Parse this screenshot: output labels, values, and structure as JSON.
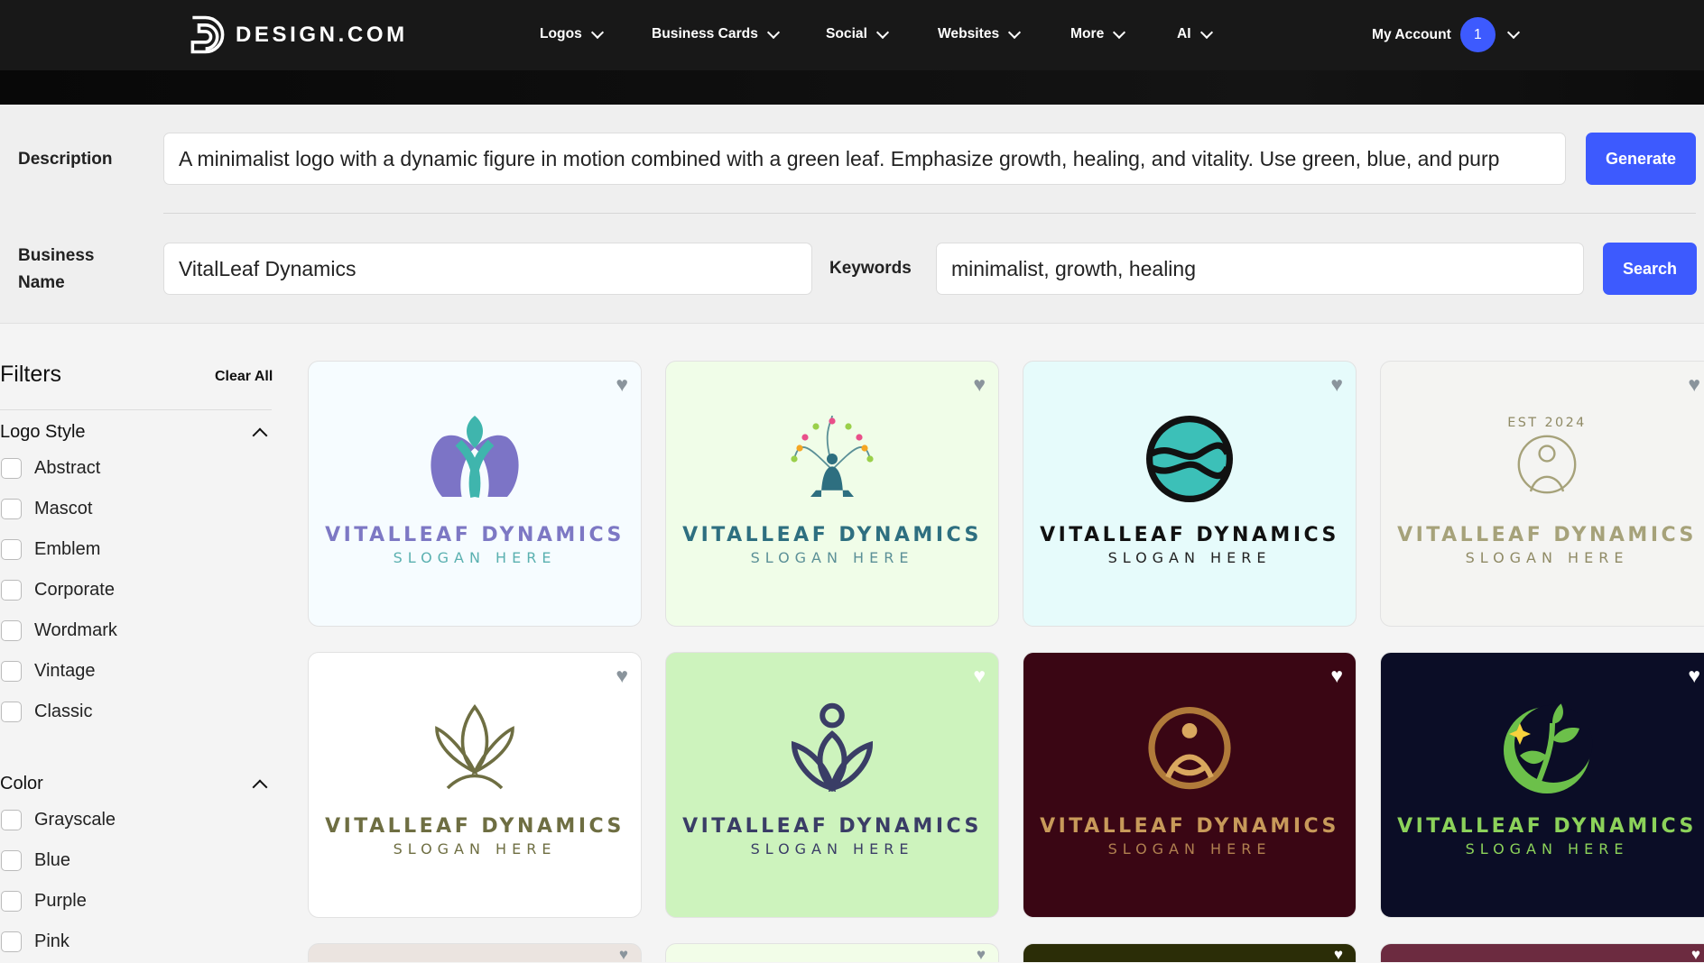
{
  "nav": {
    "brand": "DESIGN.COM",
    "items": [
      "Logos",
      "Business Cards",
      "Social",
      "Websites",
      "More",
      "AI"
    ],
    "account": "My Account",
    "badge": "1"
  },
  "form": {
    "description_label": "Description",
    "description_value": "A minimalist logo with a dynamic figure in motion combined with a green leaf. Emphasize growth, healing, and vitality. Use green, blue, and purp",
    "generate": "Generate",
    "business_label_1": "Business",
    "business_label_2": "Name",
    "business_value": "VitalLeaf Dynamics",
    "keywords_label": "Keywords",
    "keywords_value": "minimalist, growth, healing",
    "search": "Search"
  },
  "filters": {
    "title": "Filters",
    "clear": "Clear All",
    "logo_style": {
      "title": "Logo Style",
      "options": [
        "Abstract",
        "Mascot",
        "Emblem",
        "Corporate",
        "Wordmark",
        "Vintage",
        "Classic"
      ]
    },
    "color": {
      "title": "Color",
      "options": [
        "Grayscale",
        "Blue",
        "Purple",
        "Pink"
      ]
    }
  },
  "colors": {
    "accent": "#3d5afe"
  },
  "cards": [
    {
      "name": "VITALLEAF DYNAMICS",
      "slogan": "SLOGAN HERE",
      "bg": "#f6fcff",
      "fg": "#7d78c4",
      "sg": "#5ab0b0",
      "heart": "#8a949c",
      "art": "heads"
    },
    {
      "name": "VITALLEAF DYNAMICS",
      "slogan": "SLOGAN HERE",
      "bg": "#f0fde8",
      "fg": "#2e6f80",
      "sg": "#5b9097",
      "heart": "#8a949c",
      "art": "tree"
    },
    {
      "name": "VITALLEAF DYNAMICS",
      "slogan": "SLOGAN HERE",
      "bg": "#e6fbfb",
      "fg": "#111111",
      "sg": "#222222",
      "heart": "#8a949c",
      "art": "hands"
    },
    {
      "name": "VITALLEAF DYNAMICS",
      "slogan": "SLOGAN HERE",
      "bg": "#f4f4f2",
      "fg": "#a6a27a",
      "sg": "#8f8a65",
      "heart": "#8a949c",
      "art": "est",
      "art_text": "EST 2024"
    },
    {
      "name": "VITALLEAF DYNAMICS",
      "slogan": "SLOGAN HERE",
      "bg": "#ffffff",
      "fg": "#6e6e42",
      "sg": "#6e6e42",
      "heart": "#8a949c",
      "art": "lotus"
    },
    {
      "name": "VITALLEAF DYNAMICS",
      "slogan": "SLOGAN HERE",
      "bg": "#cdf3bd",
      "fg": "#3a3d66",
      "sg": "#3a3d66",
      "heart": "#ffffff",
      "art": "yoga"
    },
    {
      "name": "VITALLEAF DYNAMICS",
      "slogan": "SLOGAN HERE",
      "bg": "#3a0614",
      "fg": "#c89a5a",
      "sg": "#b08050",
      "heart": "#ffffff",
      "art": "gold"
    },
    {
      "name": "VITALLEAF DYNAMICS",
      "slogan": "SLOGAN HERE",
      "bg": "#0b0d26",
      "fg": "#8cd25a",
      "sg": "#8cd25a",
      "heart": "#ffffff",
      "art": "sprout"
    },
    {
      "name": "",
      "slogan": "",
      "bg": "#ebe4e0",
      "heart": "#8a949c"
    },
    {
      "name": "",
      "slogan": "",
      "bg": "#f2fde8",
      "heart": "#8a949c"
    },
    {
      "name": "",
      "slogan": "",
      "bg": "#2b2d07",
      "heart": "#ffffff"
    },
    {
      "name": "",
      "slogan": "",
      "bg": "#6c2b40",
      "heart": "#ffffff"
    }
  ]
}
